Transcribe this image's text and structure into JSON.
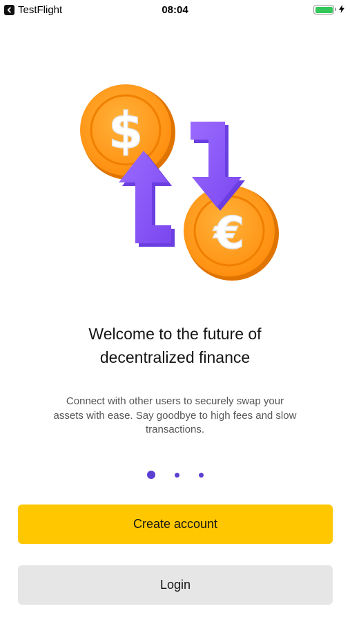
{
  "status_bar": {
    "app_name": "TestFlight",
    "time": "08:04"
  },
  "illustration": {
    "top_coin_symbol": "$",
    "bottom_coin_symbol": "€",
    "icons": [
      "dollar-coin-icon",
      "euro-coin-icon",
      "swap-arrow-icon"
    ],
    "colors": {
      "coin": "#ff9d1c",
      "coin_dark": "#e07400",
      "arrow": "#8e5cf7",
      "arrow_dark": "#6a3ee0"
    }
  },
  "onboarding": {
    "headline_line1": "Welcome to the future of",
    "headline_line2": "decentralized finance",
    "description_line1": "Connect with other users to securely swap your",
    "description_line2": "assets with ease. Say goodbye to high fees and slow",
    "description_line3": "transactions.",
    "page_count": 3,
    "active_page": 1
  },
  "buttons": {
    "create_account": "Create account",
    "login": "Login"
  },
  "colors": {
    "primary_button": "#ffc700",
    "secondary_button": "#e6e6e6",
    "pagination_dot": "#5b3fd1",
    "battery": "#34c759"
  }
}
